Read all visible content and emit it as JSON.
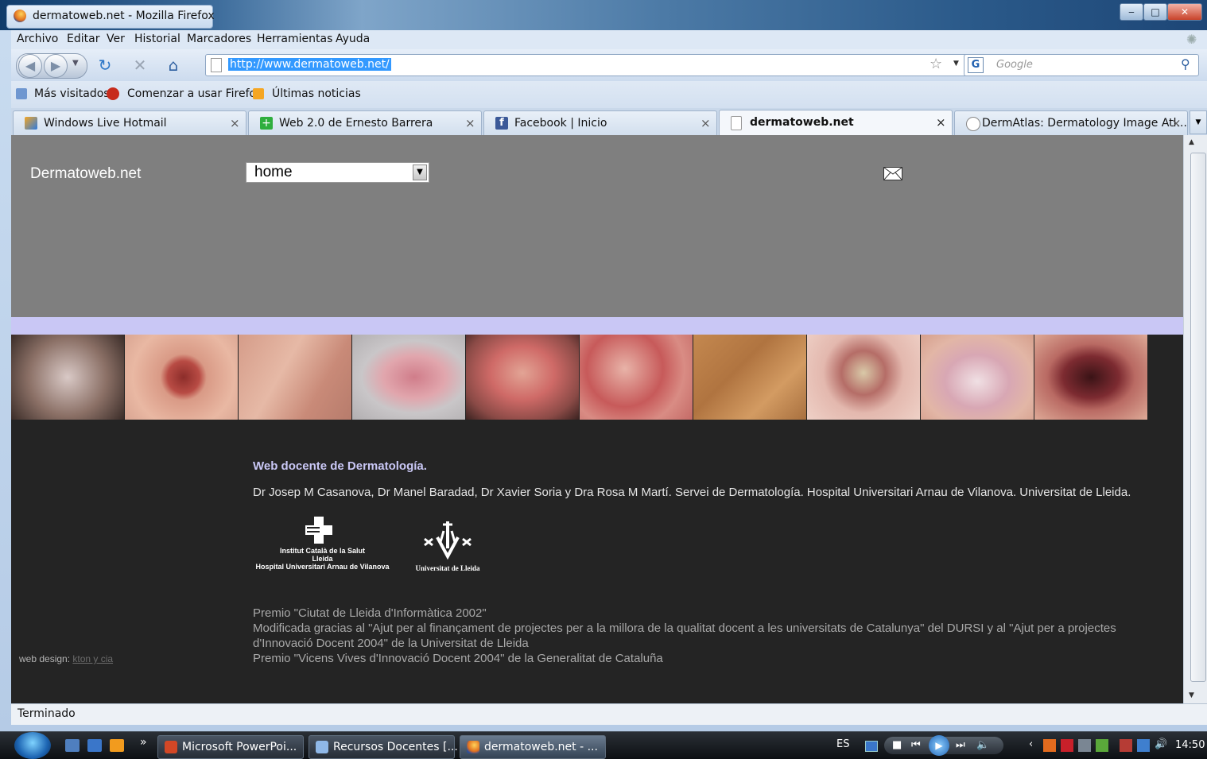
{
  "window": {
    "title": "dermatoweb.net - Mozilla Firefox"
  },
  "menu": [
    "Archivo",
    "Editar",
    "Ver",
    "Historial",
    "Marcadores",
    "Herramientas",
    "Ayuda"
  ],
  "nav": {
    "url": "http://www.dermatoweb.net/",
    "search_placeholder": "Google"
  },
  "bookmarks": [
    "Más visitados",
    "Comenzar a usar Firefox",
    "Últimas noticias"
  ],
  "tabs": [
    {
      "label": "Windows Live Hotmail"
    },
    {
      "label": "Web 2.0 de Ernesto Barrera"
    },
    {
      "label": "Facebook | Inicio"
    },
    {
      "label": "dermatoweb.net"
    },
    {
      "label": "DermAtlas: Dermatology Image Atl..."
    }
  ],
  "page": {
    "site_name": "Dermatoweb.net",
    "section_select": "home",
    "intro_title": "Web docente de Dermatología.",
    "authors": "Dr Josep M Casanova, Dr Manel Baradad, Dr Xavier Soria y Dra Rosa M Martí. Servei de Dermatología. Hospital Universitari Arnau de Vilanova. Universitat de Lleida.",
    "logo1_caption": [
      "Institut Català de la Salut",
      "Lleida",
      "Hospital Universitari Arnau de Vilanova"
    ],
    "logo2_caption": "Universitat de Lleida",
    "awards": [
      "Premio \"Ciutat de Lleida d'Informàtica 2002\"",
      "Modificada gracias al \"Ajut per al finançament de projectes per a la millora de la qualitat docent a les universitats de Catalunya\" del DURSI y al \"Ajut per a projectes",
      "d'Innovació Docent 2004\" de la Universitat de Lleida",
      "Premio \"Vicens Vives d'Innovació Docent 2004\" de la Generalitat de Cataluña"
    ],
    "web_design_label": "web design:",
    "web_design_link": "kton y cia"
  },
  "status": "Terminado",
  "taskbar": {
    "items": [
      "Microsoft PowerPoi...",
      "Recursos Docentes [...",
      "dermatoweb.net - ..."
    ],
    "language": "ES",
    "clock": "14:50"
  },
  "colors": {
    "header_band": "#7f7f7f",
    "lavender_band": "#c9c7f5",
    "page_bg": "#242424"
  }
}
